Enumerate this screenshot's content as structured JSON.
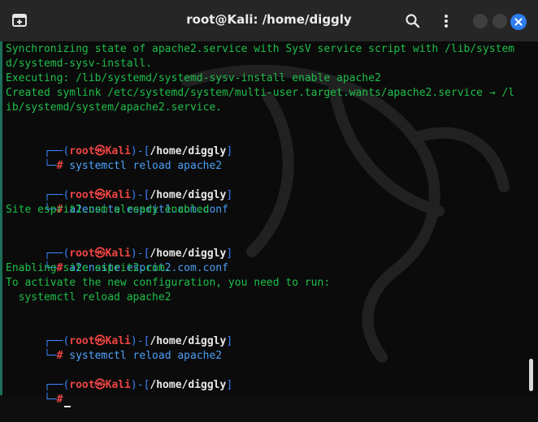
{
  "window": {
    "title": "root@Kali: /home/diggly",
    "icons": {
      "new_tab": "new-tab-icon",
      "search": "search-icon",
      "menu": "kebab-menu-icon",
      "minimize": "minimize-icon",
      "maximize": "maximize-icon",
      "close": "close-icon"
    },
    "colors": {
      "titlebar": "#262626",
      "terminal_bg": "#0b0b0b",
      "output_green": "#1fbf4a",
      "prompt_blue": "#3b82f6",
      "prompt_red": "#ef4444",
      "close_blue": "#2e7df0"
    }
  },
  "terminal": {
    "prompt": {
      "open": "┌──(",
      "user": "root",
      "at": "㉿",
      "host": "Kali",
      "mid": ")-[",
      "path": "/home/diggly",
      "close": "]",
      "second": "└─",
      "hash": "#"
    },
    "output_top": [
      "Synchronizing state of apache2.service with SysV service script with /lib/system",
      "d/systemd-sysv-install.",
      "Executing: /lib/systemd/systemd-sysv-install enable apache2",
      "Created symlink /etc/systemd/system/multi-user.target.wants/apache2.service → /l",
      "ib/systemd/system/apache2.service."
    ],
    "blocks": [
      {
        "cmd": "systemctl",
        "args": " reload apache2",
        "output": []
      },
      {
        "cmd": "a2ensite",
        "args": " esprit1.com.conf",
        "output": [
          "Site esprit1.com already enabled"
        ]
      },
      {
        "cmd": "a2ensite",
        "args": " esprit2.com.conf",
        "output": [
          "Enabling site esprit2.com.",
          "To activate the new configuration, you need to run:",
          "  systemctl reload apache2"
        ]
      },
      {
        "cmd": "systemctl",
        "args": " reload apache2",
        "output": []
      },
      {
        "cmd": "",
        "args": "",
        "output": []
      }
    ]
  }
}
